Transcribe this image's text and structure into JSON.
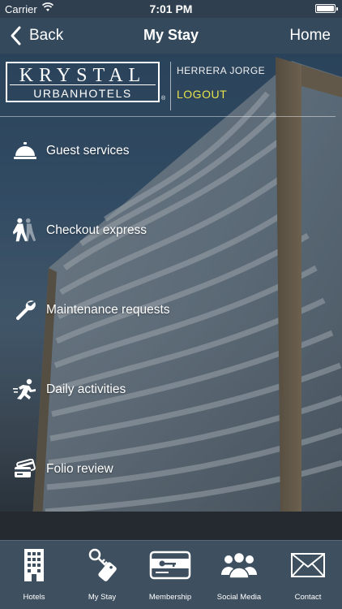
{
  "status_bar": {
    "carrier": "Carrier",
    "time": "7:01 PM"
  },
  "nav": {
    "back_label": "Back",
    "title": "My Stay",
    "home_label": "Home"
  },
  "brand": {
    "line1": "KRYSTAL",
    "line2": "URBANHOTELS",
    "registered": "®"
  },
  "user": {
    "name": "HERRERA  JORGE",
    "logout_label": "LOGOUT",
    "logout_color": "#e6e34a"
  },
  "menu": {
    "items": [
      {
        "label": "Guest services",
        "icon": "service-bell-icon"
      },
      {
        "label": "Checkout express",
        "icon": "walking-person-icon"
      },
      {
        "label": "Maintenance requests",
        "icon": "wrench-icon"
      },
      {
        "label": "Daily activities",
        "icon": "running-person-icon"
      },
      {
        "label": "Folio review",
        "icon": "credit-cards-icon"
      }
    ]
  },
  "tab_bar": {
    "tabs": [
      {
        "label": "Hotels",
        "icon": "building-icon"
      },
      {
        "label": "My Stay",
        "icon": "key-tag-icon"
      },
      {
        "label": "Membership",
        "icon": "key-card-icon"
      },
      {
        "label": "Social Media",
        "icon": "people-group-icon"
      },
      {
        "label": "Contact",
        "icon": "envelope-icon"
      }
    ]
  },
  "colors": {
    "nav_bg": "#34495c",
    "tab_bar_bg": "#3e505f",
    "accent_logout": "#e6e34a"
  }
}
